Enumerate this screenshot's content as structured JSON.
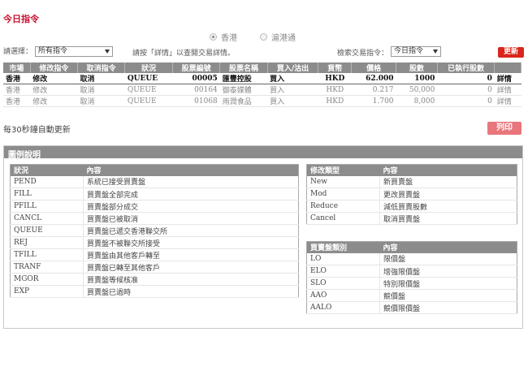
{
  "page_title": "今日指令",
  "markets": [
    {
      "label": "香港",
      "selected": true
    },
    {
      "label": "滬港通",
      "selected": false
    }
  ],
  "filter": {
    "select_label": "請選擇：",
    "select_value": "所有指令",
    "hint": "請按「詳情」以查閱交易詳情。",
    "search_label": "檢索交易指令：",
    "search_value": "今日指令",
    "refresh_label": "更新"
  },
  "orders": {
    "headers": [
      "市場",
      "修改指令",
      "取消指令",
      "狀況",
      "股票編號",
      "股票名稱",
      "買入/沽出",
      "貨幣",
      "價格",
      "股數",
      "已執行股數",
      ""
    ],
    "rows": [
      [
        "香港",
        "修改",
        "取消",
        "QUEUE",
        "00005",
        "匯豐控股",
        "買入",
        "HKD",
        "62.000",
        "1000",
        "0",
        "詳情"
      ],
      [
        "香港",
        "修改",
        "取消",
        "QUEUE",
        "00164",
        "御泰媒體",
        "買入",
        "HKD",
        "0.217",
        "50,000",
        "0",
        "詳情"
      ],
      [
        "香港",
        "修改",
        "取消",
        "QUEUE",
        "01068",
        "雨潤食品",
        "買入",
        "HKD",
        "1.700",
        "8,000",
        "0",
        "詳情"
      ]
    ]
  },
  "auto_refresh_text": "每30秒鐘自動更新",
  "print_label": "列印",
  "legend": {
    "title": "圖例說明",
    "status_table": {
      "headers": [
        "狀況",
        "內容"
      ],
      "rows": [
        [
          "PEND",
          "系統已接受買賣盤"
        ],
        [
          "FILL",
          "買賣盤全部完成"
        ],
        [
          "PFILL",
          "買賣盤部分成交"
        ],
        [
          "CANCL",
          "買賣盤已被取消"
        ],
        [
          "QUEUE",
          "買賣盤已遞交香港聯交所"
        ],
        [
          "REJ",
          "買賣盤不被聯交所接受"
        ],
        [
          "TFILL",
          "買賣盤由其他客戶轉至"
        ],
        [
          "TRANF",
          "買賣盤已轉至其他客戶"
        ],
        [
          "MGOR",
          "買賣盤等候核准"
        ],
        [
          "EXP",
          "買賣盤已過時"
        ]
      ]
    },
    "modify_table": {
      "headers": [
        "修改類型",
        "內容"
      ],
      "rows": [
        [
          "New",
          "新買賣盤"
        ],
        [
          "Mod",
          "更改買賣盤"
        ],
        [
          "Reduce",
          "減低買賣股數"
        ],
        [
          "Cancel",
          "取消買賣盤"
        ]
      ]
    },
    "type_table": {
      "headers": [
        "買賣盤類別",
        "內容"
      ],
      "rows": [
        [
          "LO",
          "限價盤"
        ],
        [
          "ELO",
          "增強限價盤"
        ],
        [
          "SLO",
          "特別限價盤"
        ],
        [
          "AAO",
          "競價盤"
        ],
        [
          "AALO",
          "競價限價盤"
        ]
      ]
    }
  }
}
